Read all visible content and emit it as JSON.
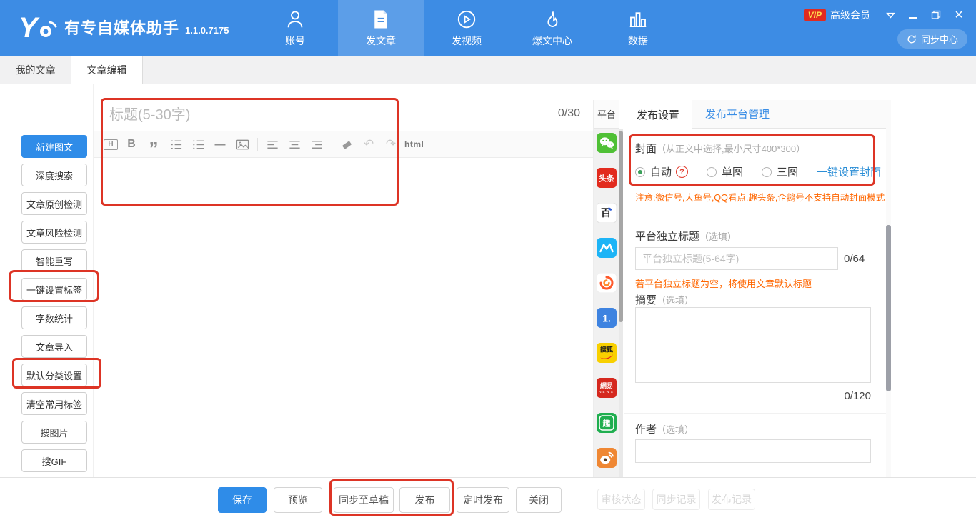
{
  "app": {
    "title": "有专自媒体助手",
    "version": "1.1.0.7175",
    "vip_badge": "VIP",
    "membership": "高级会员",
    "sync_center": "同步中心"
  },
  "nav": {
    "items": [
      {
        "label": "账号",
        "icon": "user"
      },
      {
        "label": "发文章",
        "icon": "article",
        "selected": true
      },
      {
        "label": "发视频",
        "icon": "video"
      },
      {
        "label": "爆文中心",
        "icon": "flame"
      },
      {
        "label": "数据",
        "icon": "bar-chart"
      }
    ]
  },
  "tabs": {
    "items": [
      {
        "label": "我的文章"
      },
      {
        "label": "文章编辑",
        "active": true
      }
    ]
  },
  "sidebar": {
    "items": [
      {
        "label": "新建图文",
        "primary": true
      },
      {
        "label": "深度搜索"
      },
      {
        "label": "文章原创检测"
      },
      {
        "label": "文章风险检测"
      },
      {
        "label": "智能重写"
      },
      {
        "label": "一键设置标签",
        "highlighted": true
      },
      {
        "label": "字数统计"
      },
      {
        "label": "文章导入"
      },
      {
        "label": "默认分类设置",
        "highlighted": true
      },
      {
        "label": "清空常用标签"
      },
      {
        "label": "搜图片"
      },
      {
        "label": "搜GIF"
      }
    ]
  },
  "editor": {
    "title_placeholder": "标题(5-30字)",
    "title_counter": "0/30",
    "toolbar_html_label": "html"
  },
  "icons": {
    "heading": "H",
    "bold": "B",
    "quote": "”",
    "hr": "—",
    "undo": "↶",
    "redo": "↷"
  },
  "platform_panel": {
    "header": "平台",
    "platforms": [
      {
        "name": "wechat"
      },
      {
        "name": "toutiao",
        "text": "头条"
      },
      {
        "name": "baijiahao",
        "text": "百"
      },
      {
        "name": "dayuhao"
      },
      {
        "name": "phoenix"
      },
      {
        "name": "yidianzixun",
        "text": "1."
      },
      {
        "name": "sohu",
        "text": "搜狐"
      },
      {
        "name": "netease",
        "text": "網易",
        "subtext": "NEWS"
      },
      {
        "name": "qutoutiao",
        "text": "趣"
      },
      {
        "name": "weibo"
      }
    ]
  },
  "settings": {
    "tabs": [
      {
        "label": "发布设置",
        "active": true
      },
      {
        "label": "发布平台管理"
      }
    ],
    "cover": {
      "label": "封面",
      "hint": "（从正文中选择,最小尺寸400*300）",
      "options": [
        {
          "label": "自动",
          "selected": true,
          "help": true
        },
        {
          "label": "单图"
        },
        {
          "label": "三图"
        }
      ],
      "help_glyph": "?",
      "action_link": "一键设置封面",
      "warning": "注意:微信号,大鱼号,QQ看点,趣头条,企鹅号不支持自动封面模式"
    },
    "platform_title": {
      "label": "平台独立标题",
      "optional": "（选填）",
      "placeholder": "平台独立标题(5-64字)",
      "counter": "0/64",
      "note": "若平台独立标题为空，将使用文章默认标题"
    },
    "summary": {
      "label": "摘要",
      "optional": "（选填）",
      "counter": "0/120"
    },
    "author": {
      "label": "作者",
      "optional": "（选填）"
    }
  },
  "footer": {
    "buttons": [
      {
        "label": "保存",
        "primary": true
      },
      {
        "label": "预览"
      },
      {
        "label": "同步至草稿"
      },
      {
        "label": "发布"
      },
      {
        "label": "定时发布"
      },
      {
        "label": "关闭"
      }
    ],
    "disabled_buttons": [
      {
        "label": "审核状态"
      },
      {
        "label": "同步记录"
      },
      {
        "label": "发布记录"
      }
    ]
  },
  "colors": {
    "header_blue": "#3d8ce4",
    "primary_blue": "#2f8ce8",
    "link_blue": "#3a8ee6",
    "annotation_red": "#dd3425",
    "warning_orange": "#ff6600",
    "vip_red": "#e02b20",
    "vip_text": "#ffd94d",
    "radio_green": "#3aa05a"
  }
}
